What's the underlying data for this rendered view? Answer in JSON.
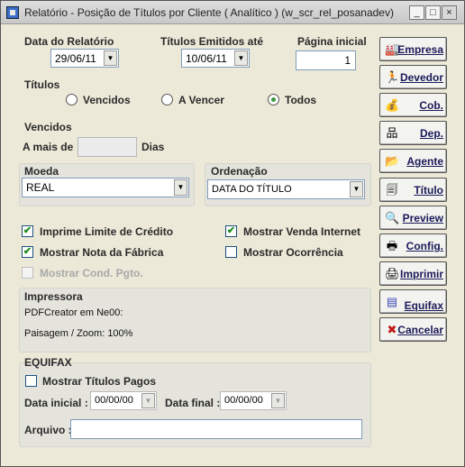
{
  "window": {
    "title": "Relatório - Posição de Títulos por Cliente ( Analítico ) (w_scr_rel_posanadev)",
    "min": "_",
    "max": "□",
    "close": "×"
  },
  "dates": {
    "data_relatorio_label": "Data do Relatório",
    "data_relatorio_value": "29/06/11",
    "titulos_emitidos_label": "Títulos Emitidos até",
    "titulos_emitidos_value": "10/06/11",
    "pagina_inicial_label": "Página inicial",
    "pagina_inicial_value": "1"
  },
  "titulos": {
    "label": "Títulos",
    "options": [
      "Vencidos",
      "A Vencer",
      "Todos"
    ],
    "selected": "Todos"
  },
  "vencidos": {
    "label": "Vencidos",
    "a_mais_de": "A mais de",
    "days_value": "",
    "dias": "Dias"
  },
  "moeda": {
    "label": "Moeda",
    "value": "REAL"
  },
  "ordenacao": {
    "label": "Ordenação",
    "value": "DATA DO TÍTULO"
  },
  "options": {
    "imprime_limite": {
      "label": "Imprime Limite de Crédito",
      "checked": true
    },
    "mostrar_venda_internet": {
      "label": "Mostrar Venda Internet",
      "checked": true
    },
    "mostrar_nota_fabrica": {
      "label": "Mostrar Nota da Fábrica",
      "checked": true
    },
    "mostrar_ocorrencia": {
      "label": "Mostrar Ocorrência",
      "checked": false
    },
    "mostrar_cond_pgto": {
      "label": "Mostrar Cond. Pgto.",
      "checked": false,
      "disabled": true
    }
  },
  "impressora": {
    "label": "Impressora",
    "printer": "PDFCreator em Ne00:",
    "orientation": "Paisagem / Zoom: 100%"
  },
  "equifax": {
    "label": "EQUIFAX",
    "mostrar_titulos_pagos": "Mostrar Títulos Pagos",
    "data_inicial_label": "Data inicial :",
    "data_inicial_value": "00/00/00",
    "data_final_label": "Data final :",
    "data_final_value": "00/00/00",
    "arquivo_label": "Arquivo :",
    "arquivo_value": ""
  },
  "buttons": [
    {
      "label": "Empresa",
      "icon": "factory-icon",
      "glyph": "🏭"
    },
    {
      "label": "Devedor",
      "icon": "person-icon",
      "glyph": "🏃"
    },
    {
      "label": "Cob.",
      "icon": "money-bag-icon",
      "glyph": "💰"
    },
    {
      "label": "Dep.",
      "icon": "org-chart-icon",
      "glyph": "品"
    },
    {
      "label": "Agente",
      "icon": "folder-icon",
      "glyph": "📂"
    },
    {
      "label": "Título",
      "icon": "documents-icon",
      "glyph": "🗐"
    },
    {
      "label": "Preview",
      "icon": "preview-icon",
      "glyph": "🔍"
    },
    {
      "label": "Config.",
      "icon": "printer-settings-icon",
      "glyph": "🖶"
    },
    {
      "label": "Imprimir",
      "icon": "printer-icon",
      "glyph": "🖨"
    },
    {
      "label": "Equifax",
      "icon": "equifax-icon",
      "glyph": "▤"
    },
    {
      "label": "Cancelar",
      "icon": "cancel-x-icon",
      "glyph": "✖"
    }
  ]
}
